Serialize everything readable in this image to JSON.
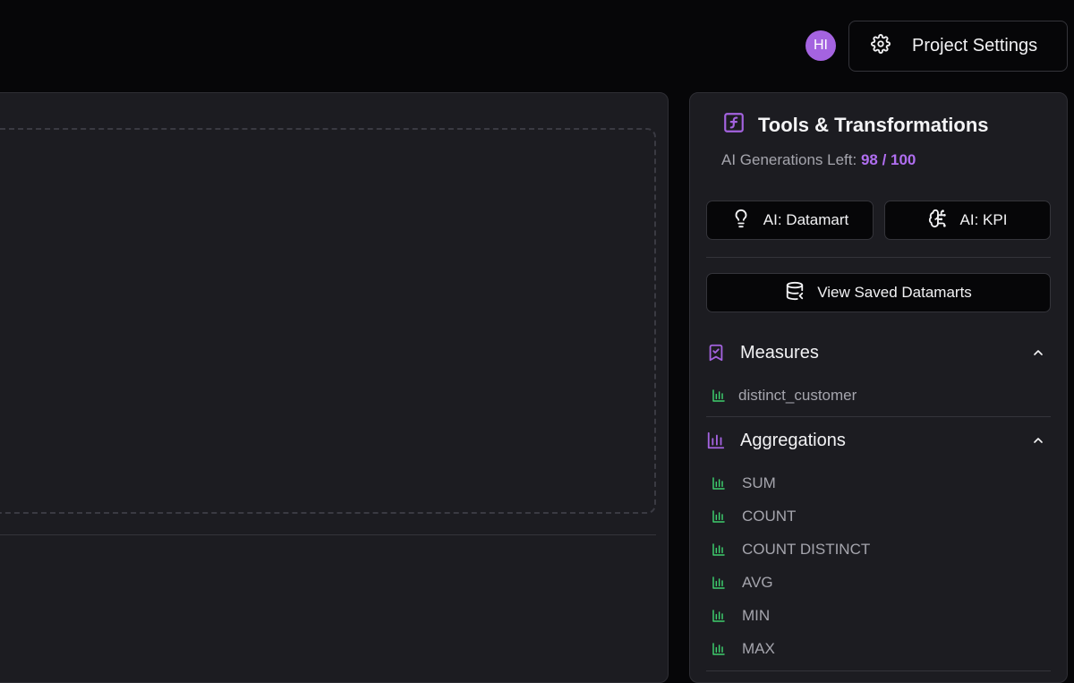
{
  "header": {
    "avatar_initials": "HI",
    "settings_label": "Project Settings"
  },
  "tools": {
    "title": "Tools & Transformations",
    "ai_generations_label": "AI Generations Left:",
    "ai_generations_count": "98 / 100",
    "ai_datamart_label": "AI: Datamart",
    "ai_kpi_label": "AI: KPI",
    "view_saved_label": "View Saved Datamarts"
  },
  "measures": {
    "title": "Measures",
    "items": [
      "distinct_customer"
    ]
  },
  "aggregations": {
    "title": "Aggregations",
    "items": [
      "SUM",
      "COUNT",
      "COUNT DISTINCT",
      "AVG",
      "MIN",
      "MAX"
    ]
  },
  "colors": {
    "accent": "#a463e0",
    "item_icon": "#3ecf6e"
  }
}
